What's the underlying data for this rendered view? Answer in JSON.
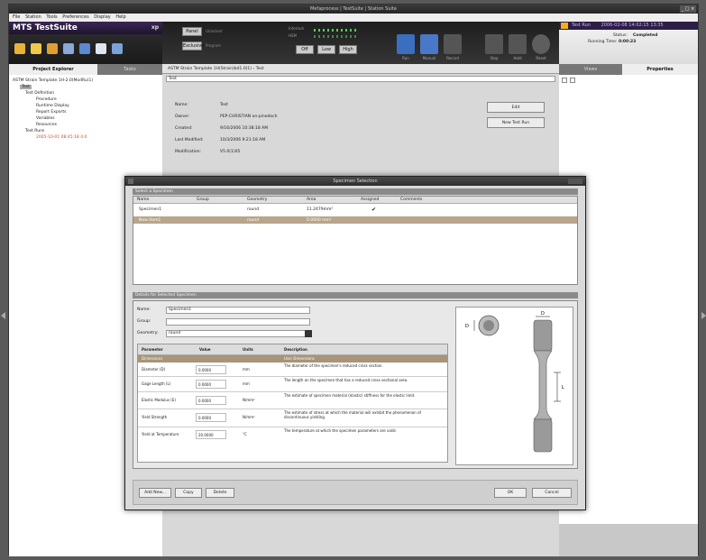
{
  "window": {
    "title": "Mefaprocess | TestSuite | Station Suite",
    "controls": "_ □ ×"
  },
  "menu": [
    "File",
    "Station",
    "Tools",
    "Preferences",
    "Display",
    "Help"
  ],
  "brand": {
    "name": "MTS TestSuite",
    "edition": "xp"
  },
  "center_toolbar": {
    "panel_label": "Panel",
    "panel_value": "Unlocked",
    "exclusive_label": "Exclusive",
    "program_label": "Program",
    "interlock_label": "Interlock",
    "hsm_label": "HSM",
    "off_label": "Off",
    "low_label": "Low",
    "high_label": "High",
    "tools": [
      "Run",
      "Manual",
      "Record",
      "Stop",
      "Hold",
      "Reset"
    ]
  },
  "status": {
    "test_label": "Test Run",
    "test_value": "2006-02-08 14:02:15 13:35",
    "status_label": "Status:",
    "status_value": "Completed",
    "running_label": "Running Time:",
    "running_value": "0:00:23"
  },
  "left_panel": {
    "tabs": [
      "Project Explorer",
      "Tasks"
    ],
    "tree": [
      "ASTM Strain Template 1H-2.0(ModRu)1)",
      "Test",
      "Test Definition",
      "Procedure",
      "Runtime Display",
      "Report Exports",
      "Variables",
      "Resources",
      "Test Runs",
      "2005-10-01 08:45:18 4.0"
    ]
  },
  "middle": {
    "breadcrumb": "ASTM Strain Template 1H(Strain)bd1.0(1)  ›  Test",
    "subtitle": "Test",
    "props": [
      {
        "label": "Name:",
        "value": "Test"
      },
      {
        "label": "Owner:",
        "value": "PEP-CHRISTIAN on-pinedoch"
      },
      {
        "label": "Created:",
        "value": "9/16/2006 10:38:18 AM"
      },
      {
        "label": "Last Modified:",
        "value": "10/3/2006 9:21:18 AM"
      },
      {
        "label": "Modification:",
        "value": "V5.0(1)05"
      }
    ],
    "buttons": [
      "Edit",
      "New Test Run"
    ]
  },
  "right_panel": {
    "tabs": [
      "Views",
      "Properties"
    ]
  },
  "dialog": {
    "title": "Specimen Selection",
    "section1": "Select a Specimen",
    "grid_headers": [
      "Name",
      "Group",
      "Geometry",
      "Area",
      "Assigned",
      "Comments"
    ],
    "grid_rows": [
      {
        "name": "Specimen1",
        "group": "",
        "geometry": "round",
        "area": "11.2479mm²",
        "assigned": "✔",
        "comments": ""
      },
      {
        "name": "New Item1",
        "group": "",
        "geometry": "round",
        "area": "0.0000 mm²",
        "assigned": "",
        "comments": ""
      }
    ],
    "section2": "Details for Selected Specimen",
    "fields": [
      {
        "label": "Name:",
        "value": "Specimen1"
      },
      {
        "label": "Group:",
        "value": ""
      },
      {
        "label": "Geometry:",
        "value": "round"
      }
    ],
    "param_headers": [
      "Parameter",
      "Value",
      "Units",
      "Description"
    ],
    "param_section": "Dimensions",
    "param_section_desc": "User Dimensions",
    "params": [
      {
        "name": "Diameter (D)",
        "value": "0.0000",
        "unit": "mm",
        "desc": "The diameter of the specimen's reduced cross section."
      },
      {
        "name": "Gage Length (L)",
        "value": "0.0000",
        "unit": "mm",
        "desc": "The length on the specimen that has a reduced cross sectional area."
      },
      {
        "name": "Elastic Modulus (E)",
        "value": "0.0000",
        "unit": "N/mm²",
        "desc": "The estimate of specimen material (elastic) stiffness for the elastic limit."
      },
      {
        "name": "Yield Strength",
        "value": "0.0000",
        "unit": "N/mm²",
        "desc": "The estimate of stress at which the material will exhibit the phenomenon of discontinuous yielding."
      },
      {
        "name": "Yield at Temperature",
        "value": "20.0000",
        "unit": "°C",
        "desc": "The temperature at which the specimen parameters are valid."
      }
    ],
    "diagram_labels": {
      "d": "D",
      "l": "L"
    },
    "buttons": {
      "add": "Add New...",
      "copy": "Copy",
      "delete": "Delete",
      "ok": "OK",
      "cancel": "Cancel"
    }
  }
}
